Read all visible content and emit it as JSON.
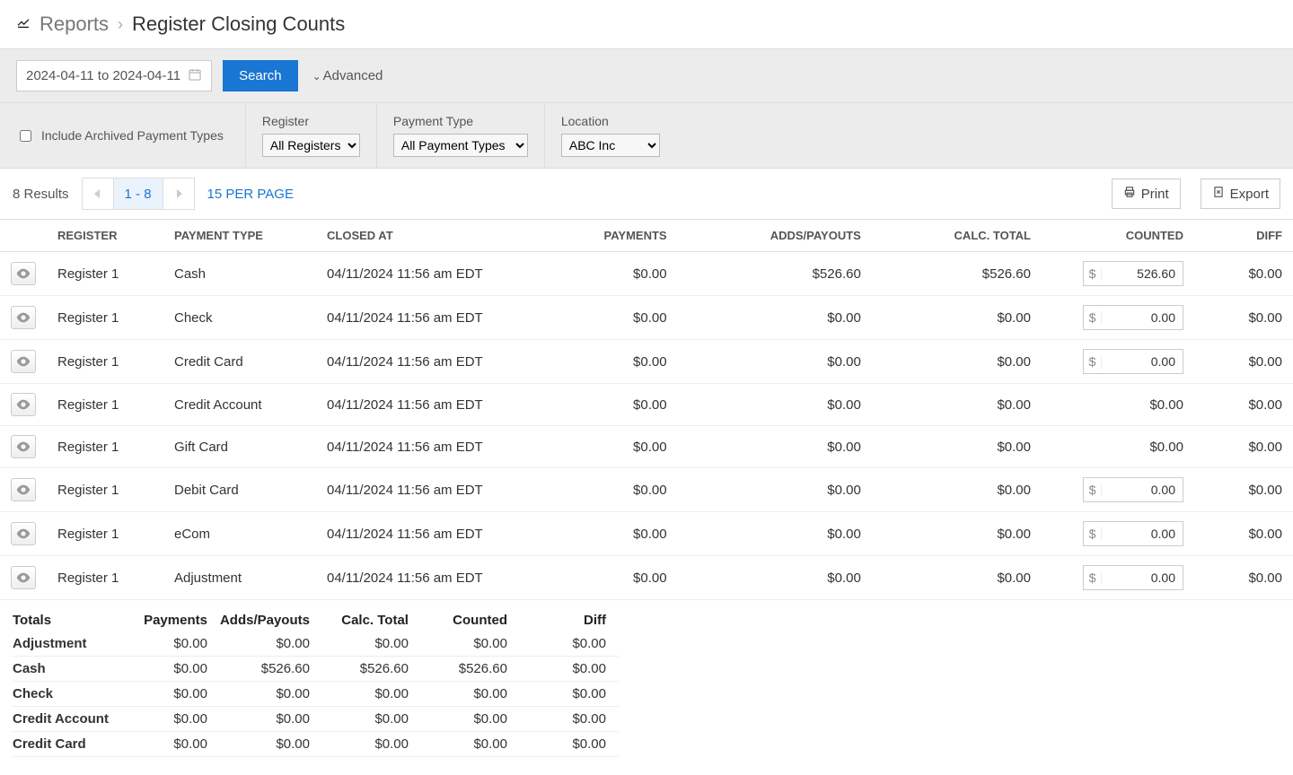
{
  "breadcrumb": {
    "parent": "Reports",
    "current": "Register Closing Counts"
  },
  "search": {
    "date_range": "2024-04-11 to 2024-04-11",
    "search_btn": "Search",
    "advanced": "Advanced"
  },
  "filters": {
    "include_archived_label": "Include Archived Payment Types",
    "register_label": "Register",
    "register_value": "All Registers",
    "payment_type_label": "Payment Type",
    "payment_type_value": "All Payment Types",
    "location_label": "Location",
    "location_value": "ABC Inc"
  },
  "results_bar": {
    "count_text": "8 Results",
    "page_range": "1 - 8",
    "per_page": "15 PER PAGE",
    "print": "Print",
    "export": "Export"
  },
  "columns": {
    "register": "REGISTER",
    "payment_type": "PAYMENT TYPE",
    "closed_at": "CLOSED AT",
    "payments": "PAYMENTS",
    "adds_payouts": "ADDS/PAYOUTS",
    "calc_total": "CALC. TOTAL",
    "counted": "COUNTED",
    "diff": "DIFF"
  },
  "rows": [
    {
      "register": "Register 1",
      "payment_type": "Cash",
      "closed_at": "04/11/2024 11:56 am EDT",
      "payments": "$0.00",
      "adds": "$526.60",
      "calc": "$526.60",
      "counted": "526.60",
      "counted_editable": true,
      "diff": "$0.00"
    },
    {
      "register": "Register 1",
      "payment_type": "Check",
      "closed_at": "04/11/2024 11:56 am EDT",
      "payments": "$0.00",
      "adds": "$0.00",
      "calc": "$0.00",
      "counted": "0.00",
      "counted_editable": true,
      "diff": "$0.00"
    },
    {
      "register": "Register 1",
      "payment_type": "Credit Card",
      "closed_at": "04/11/2024 11:56 am EDT",
      "payments": "$0.00",
      "adds": "$0.00",
      "calc": "$0.00",
      "counted": "0.00",
      "counted_editable": true,
      "diff": "$0.00"
    },
    {
      "register": "Register 1",
      "payment_type": "Credit Account",
      "closed_at": "04/11/2024 11:56 am EDT",
      "payments": "$0.00",
      "adds": "$0.00",
      "calc": "$0.00",
      "counted": "$0.00",
      "counted_editable": false,
      "diff": "$0.00"
    },
    {
      "register": "Register 1",
      "payment_type": "Gift Card",
      "closed_at": "04/11/2024 11:56 am EDT",
      "payments": "$0.00",
      "adds": "$0.00",
      "calc": "$0.00",
      "counted": "$0.00",
      "counted_editable": false,
      "diff": "$0.00"
    },
    {
      "register": "Register 1",
      "payment_type": "Debit Card",
      "closed_at": "04/11/2024 11:56 am EDT",
      "payments": "$0.00",
      "adds": "$0.00",
      "calc": "$0.00",
      "counted": "0.00",
      "counted_editable": true,
      "diff": "$0.00"
    },
    {
      "register": "Register 1",
      "payment_type": "eCom",
      "closed_at": "04/11/2024 11:56 am EDT",
      "payments": "$0.00",
      "adds": "$0.00",
      "calc": "$0.00",
      "counted": "0.00",
      "counted_editable": true,
      "diff": "$0.00"
    },
    {
      "register": "Register 1",
      "payment_type": "Adjustment",
      "closed_at": "04/11/2024 11:56 am EDT",
      "payments": "$0.00",
      "adds": "$0.00",
      "calc": "$0.00",
      "counted": "0.00",
      "counted_editable": true,
      "diff": "$0.00"
    }
  ],
  "totals": {
    "headers": {
      "totals": "Totals",
      "payments": "Payments",
      "adds": "Adds/Payouts",
      "calc": "Calc. Total",
      "counted": "Counted",
      "diff": "Diff"
    },
    "rows": [
      {
        "label": "Adjustment",
        "payments": "$0.00",
        "adds": "$0.00",
        "calc": "$0.00",
        "counted": "$0.00",
        "diff": "$0.00"
      },
      {
        "label": "Cash",
        "payments": "$0.00",
        "adds": "$526.60",
        "calc": "$526.60",
        "counted": "$526.60",
        "diff": "$0.00"
      },
      {
        "label": "Check",
        "payments": "$0.00",
        "adds": "$0.00",
        "calc": "$0.00",
        "counted": "$0.00",
        "diff": "$0.00"
      },
      {
        "label": "Credit Account",
        "payments": "$0.00",
        "adds": "$0.00",
        "calc": "$0.00",
        "counted": "$0.00",
        "diff": "$0.00"
      },
      {
        "label": "Credit Card",
        "payments": "$0.00",
        "adds": "$0.00",
        "calc": "$0.00",
        "counted": "$0.00",
        "diff": "$0.00"
      }
    ]
  },
  "currency_prefix": "$"
}
